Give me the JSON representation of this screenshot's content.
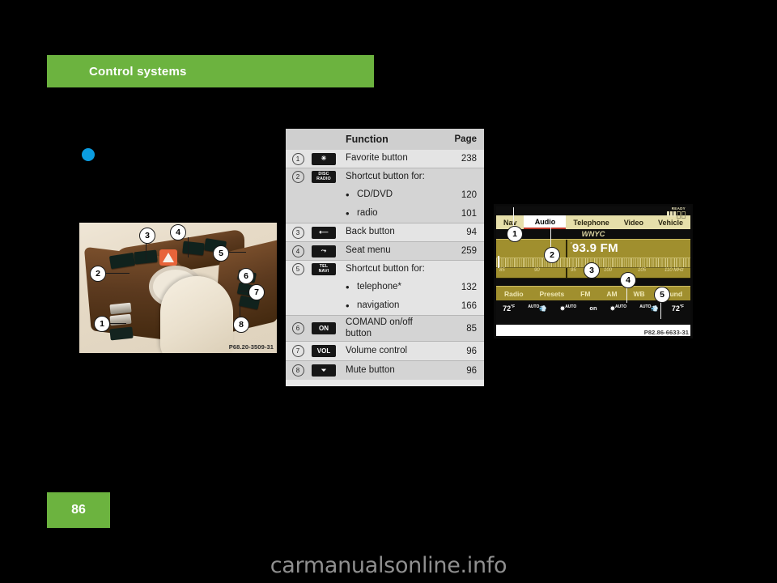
{
  "section": {
    "title": "Control systems"
  },
  "page": {
    "number": "86"
  },
  "watermark": {
    "text": "carmanualsonline.info"
  },
  "console_photo": {
    "code": "P68.20-3509-31",
    "callouts": [
      "1",
      "2",
      "3",
      "4",
      "5",
      "6",
      "7",
      "8"
    ]
  },
  "table": {
    "headers": {
      "num": "",
      "icon": "",
      "function": "Function",
      "page": "Page"
    },
    "rows": [
      {
        "num": "1",
        "icon": "favorite-star",
        "icon_text": "✳",
        "icon_lines": [],
        "label": "Favorite button",
        "page": "238",
        "type": "main"
      },
      {
        "num": "2",
        "icon": "disc-radio",
        "icon_text": "",
        "icon_lines": [
          "DISC",
          "RADIO"
        ],
        "label": "Shortcut button for:",
        "page": "",
        "type": "main"
      },
      {
        "num": "",
        "icon": "",
        "icon_text": "",
        "icon_lines": [],
        "label": "CD/DVD",
        "page": "120",
        "type": "sub"
      },
      {
        "num": "",
        "icon": "",
        "icon_text": "",
        "icon_lines": [],
        "label": "radio",
        "page": "101",
        "type": "sub"
      },
      {
        "num": "3",
        "icon": "back-arrow",
        "icon_text": "⟵",
        "icon_lines": [],
        "label": "Back button",
        "page": "94",
        "type": "main"
      },
      {
        "num": "4",
        "icon": "seat-menu",
        "icon_text": "⤳",
        "icon_lines": [],
        "label": "Seat menu",
        "page": "259",
        "type": "main"
      },
      {
        "num": "5",
        "icon": "tel-navi",
        "icon_text": "",
        "icon_lines": [
          "TEL",
          "NAVI"
        ],
        "label": "Shortcut button for:",
        "page": "",
        "type": "main"
      },
      {
        "num": "",
        "icon": "",
        "icon_text": "",
        "icon_lines": [],
        "label": "telephone*",
        "page": "132",
        "type": "sub"
      },
      {
        "num": "",
        "icon": "",
        "icon_text": "",
        "icon_lines": [],
        "label": "navigation",
        "page": "166",
        "type": "sub"
      },
      {
        "num": "6",
        "icon": "power-on",
        "icon_text": "ON",
        "icon_lines": [],
        "label": "COMAND on/off button",
        "page": "85",
        "type": "main"
      },
      {
        "num": "7",
        "icon": "volume-control",
        "icon_text": "VOL",
        "icon_lines": [],
        "label": "Volume control",
        "page": "96",
        "type": "main"
      },
      {
        "num": "8",
        "icon": "mute-speaker",
        "icon_text": "⏷",
        "icon_lines": [],
        "label": "Mute button",
        "page": "96",
        "type": "main"
      }
    ]
  },
  "comand": {
    "code": "P82.86-6633-31",
    "signal": {
      "ready_label": "READY",
      "bars_on": 3,
      "bars_off": 2
    },
    "tabs": [
      {
        "label": "Nav",
        "active": false
      },
      {
        "label": "Audio",
        "active": true
      },
      {
        "label": "Telephone",
        "active": false
      },
      {
        "label": "Video",
        "active": false
      },
      {
        "label": "Vehicle",
        "active": false
      }
    ],
    "station_name": "WNYC",
    "frequency": "93.9 FM",
    "frequency_marker": "′",
    "scale_labels": [
      "85",
      "90",
      "95",
      "100",
      "105",
      "110 MHz"
    ],
    "menu_items": [
      "Radio",
      "Presets",
      "FM",
      "AM",
      "WB",
      "Sound"
    ],
    "status_items": [
      {
        "text": "72",
        "unit": "°F",
        "kind": "temp"
      },
      {
        "text": "AUTO",
        "kind": "auto-vent"
      },
      {
        "text": "AUTO",
        "kind": "auto-fan"
      },
      {
        "text": "on",
        "kind": "plain"
      },
      {
        "text": "AUTO",
        "kind": "auto-fan"
      },
      {
        "text": "AUTO",
        "kind": "auto-vent"
      },
      {
        "text": "72",
        "unit": "°F",
        "kind": "temp"
      }
    ],
    "callouts": [
      "1",
      "2",
      "3",
      "4",
      "5"
    ]
  },
  "colors": {
    "brand_green": "#6cb33f",
    "marker_blue": "#0b9ce0",
    "comand_gold": "#a08f2e",
    "tab_cream": "#e6dfaa",
    "accent_red": "#c0392b"
  }
}
